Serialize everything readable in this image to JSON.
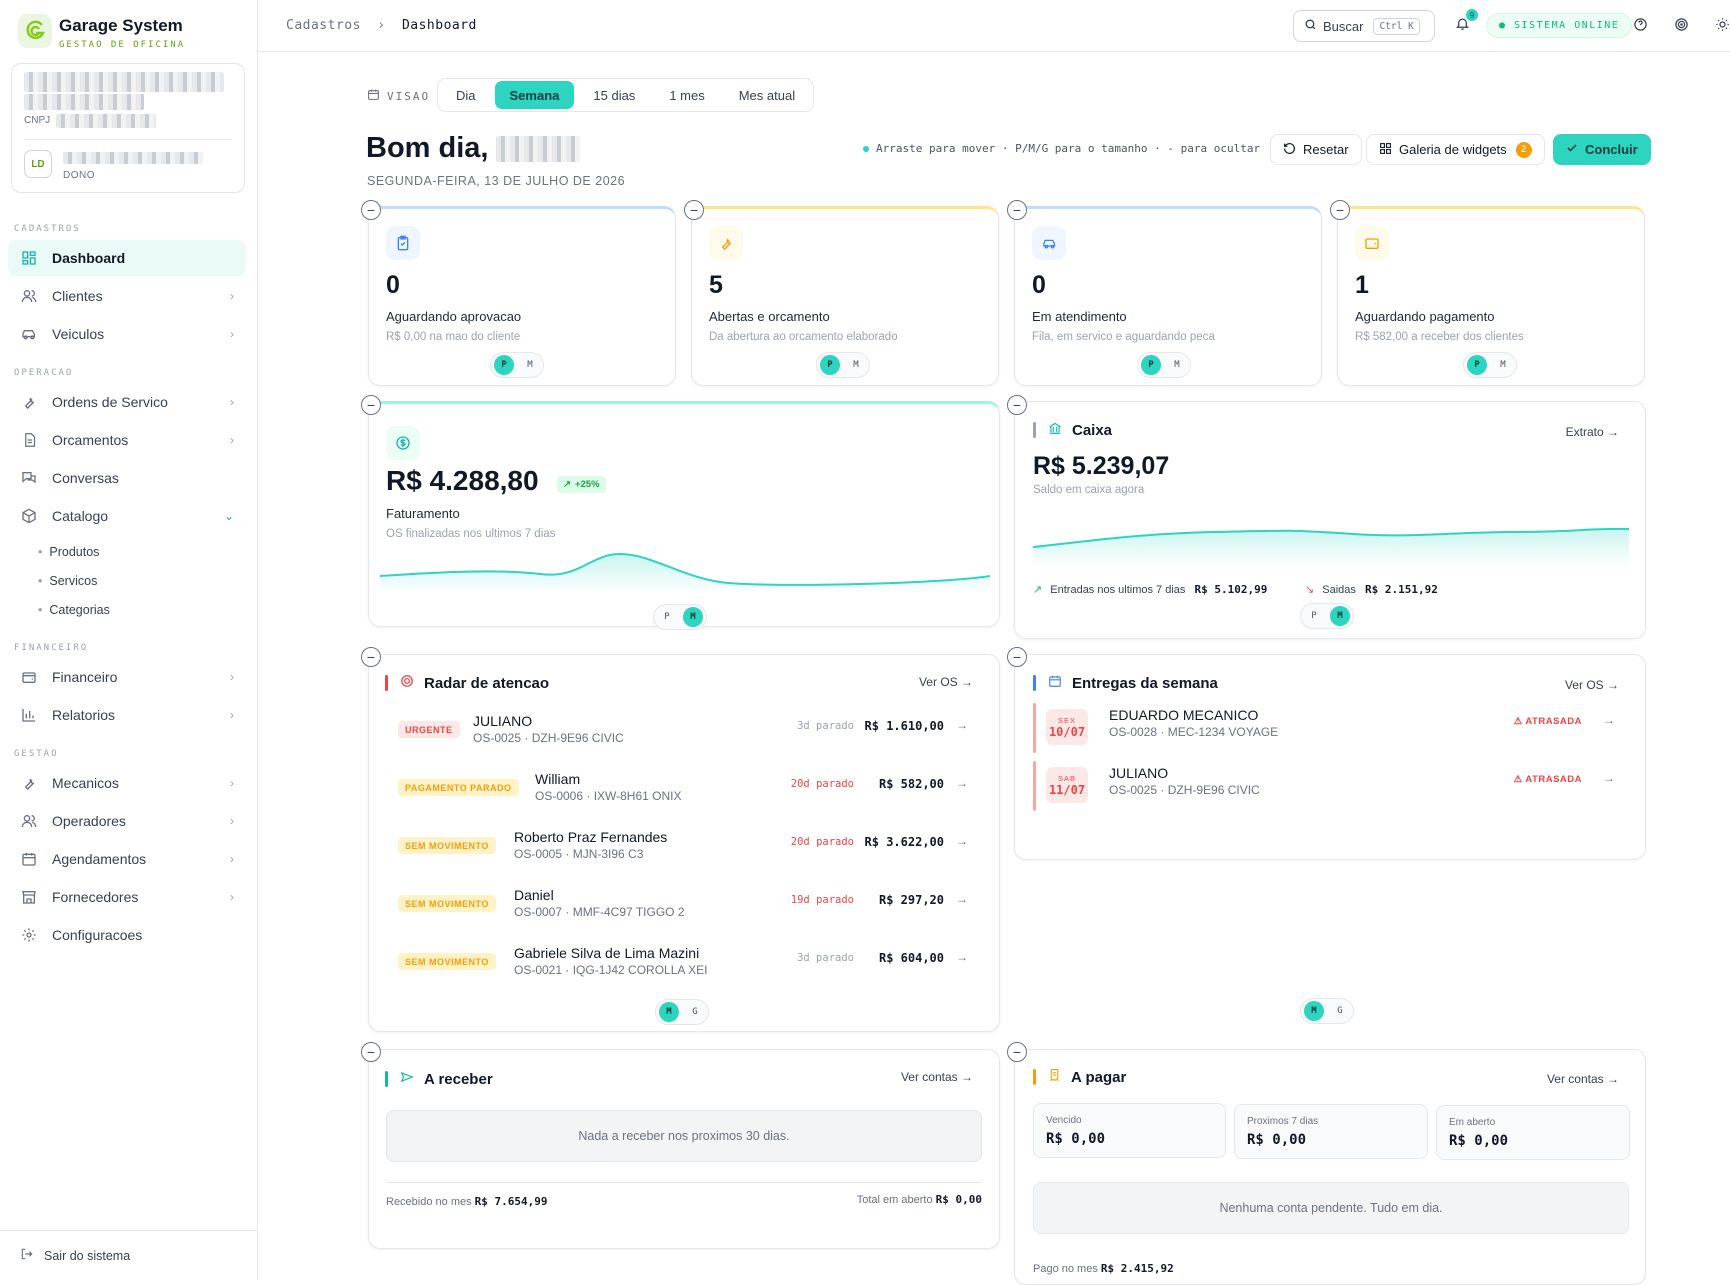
{
  "app": {
    "title": "Garage System",
    "subtitle": "GESTAO DE OFICINA"
  },
  "company": {
    "cnpj_label": "CNPJ",
    "avatar": "LD",
    "role": "DONO"
  },
  "sidebar": {
    "sections": {
      "cadastros": "CADASTROS",
      "operacao": "OPERACAO",
      "financeiro": "FINANCEIRO",
      "gestao": "GESTAO"
    },
    "items": {
      "dashboard": "Dashboard",
      "clientes": "Clientes",
      "veiculos": "Veiculos",
      "ordens": "Ordens de Servico",
      "orcamentos": "Orcamentos",
      "conversas": "Conversas",
      "catalogo": "Catalogo",
      "financeiro": "Financeiro",
      "relatorios": "Relatorios",
      "mecanicos": "Mecanicos",
      "operadores": "Operadores",
      "agendamentos": "Agendamentos",
      "fornecedores": "Fornecedores",
      "configuracoes": "Configuracoes"
    },
    "catalogo_sub": {
      "produtos": "Produtos",
      "servicos": "Servicos",
      "categorias": "Categorias"
    },
    "logout": "Sair do sistema"
  },
  "topbar": {
    "breadcrumb_root": "Cadastros",
    "breadcrumb_sep": "›",
    "breadcrumb_current": "Dashboard",
    "search_label": "Buscar",
    "search_kbd": "Ctrl K",
    "notifications_count": "9",
    "status": "● SISTEMA ONLINE"
  },
  "view": {
    "label": "VISAO",
    "options": {
      "dia": "Dia",
      "semana": "Semana",
      "d15": "15 dias",
      "mes1": "1 mes",
      "mes_atual": "Mes atual"
    },
    "selected": "Semana"
  },
  "header": {
    "greeting": "Bom dia,",
    "date": "SEGUNDA-FEIRA, 13 DE JULHO DE 2026",
    "hint": "Arraste para mover · P/M/G para o tamanho · - para ocultar",
    "reset": "Resetar",
    "gallery": "Galeria de widgets",
    "gallery_count": "2",
    "done": "Concluir"
  },
  "kpis": {
    "k1": {
      "value": "0",
      "label": "Aguardando aprovacao",
      "sub": "R$ 0,00 na mao do cliente",
      "color": "#3b82f6"
    },
    "k2": {
      "value": "5",
      "label": "Abertas e orcamento",
      "sub": "Da abertura ao orcamento elaborado",
      "color": "#f59e0b"
    },
    "k3": {
      "value": "0",
      "label": "Em atendimento",
      "sub": "Fila, em servico e aguardando peca",
      "color": "#3b82f6"
    },
    "k4": {
      "value": "1",
      "label": "Aguardando pagamento",
      "sub": "R$ 582,00 a receber dos clientes",
      "color": "#f59e0b"
    }
  },
  "sizes": {
    "p": "P",
    "m": "M",
    "g": "G"
  },
  "faturamento": {
    "value": "R$ 4.288,80",
    "trend": "+25%",
    "label": "Faturamento",
    "sub": "OS finalizadas nos ultimos 7 dias"
  },
  "caixa": {
    "title": "Caixa",
    "link": "Extrato →",
    "value": "R$ 5.239,07",
    "sub": "Saldo em caixa agora",
    "in_label": "Entradas nos ultimos 7 dias",
    "in_value": "R$ 5.102,99",
    "out_label": "Saidas",
    "out_value": "R$ 2.151,92"
  },
  "radar": {
    "title": "Radar de atencao",
    "link": "Ver OS →",
    "rows": [
      {
        "tag": "URGENTE",
        "name": "JULIANO",
        "sub": "OS-0025 · DZH-9E96 CIVIC",
        "stopped": "3d parado",
        "amount": "R$ 1.610,00"
      },
      {
        "tag": "PAGAMENTO PARADO",
        "name": "William",
        "sub": "OS-0006 · IXW-8H61 ONIX",
        "stopped": "20d parado",
        "amount": "R$ 582,00"
      },
      {
        "tag": "SEM MOVIMENTO",
        "name": "Roberto Praz Fernandes",
        "sub": "OS-0005 · MJN-3I96 C3",
        "stopped": "20d parado",
        "amount": "R$ 3.622,00"
      },
      {
        "tag": "SEM MOVIMENTO",
        "name": "Daniel",
        "sub": "OS-0007 · MMF-4C97 TIGGO 2",
        "stopped": "19d parado",
        "amount": "R$ 297,20"
      },
      {
        "tag": "SEM MOVIMENTO",
        "name": "Gabriele Silva de Lima Mazini",
        "sub": "OS-0021 · IQG-1J42 COROLLA XEI",
        "stopped": "3d parado",
        "amount": "R$ 604,00"
      }
    ]
  },
  "entregas": {
    "title": "Entregas da semana",
    "link": "Ver OS →",
    "rows": [
      {
        "weekday": "SEX",
        "date": "10/07",
        "name": "EDUARDO MECANICO",
        "sub": "OS-0028 · MEC-1234 VOYAGE",
        "status": "ATRASADA"
      },
      {
        "weekday": "SAB",
        "date": "11/07",
        "name": "JULIANO",
        "sub": "OS-0025 · DZH-9E96 CIVIC",
        "status": "ATRASADA"
      }
    ]
  },
  "receber": {
    "title": "A receber",
    "link": "Ver contas →",
    "empty": "Nada a receber nos proximos 30 dias.",
    "received_label": "Recebido no mes",
    "received_value": "R$ 7.654,99",
    "open_label": "Total em aberto",
    "open_value": "R$ 0,00"
  },
  "pagar": {
    "title": "A pagar",
    "link": "Ver contas →",
    "boxes": [
      {
        "label": "Vencido",
        "value": "R$ 0,00"
      },
      {
        "label": "Proximos 7 dias",
        "value": "R$ 0,00"
      },
      {
        "label": "Em aberto",
        "value": "R$ 0,00"
      }
    ],
    "empty": "Nenhuma conta pendente. Tudo em dia.",
    "paid_label": "Pago no mes",
    "paid_value": "R$ 2.415,92"
  },
  "colors": {
    "accent": "#2dd4bf",
    "danger": "#ef4444",
    "warning": "#f59e0b",
    "info": "#3b82f6"
  }
}
